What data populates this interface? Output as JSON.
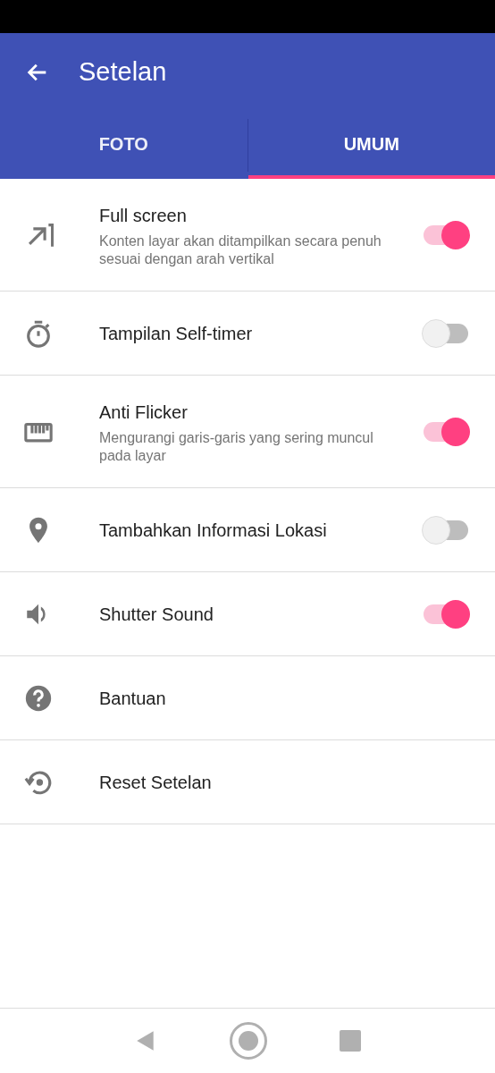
{
  "header": {
    "title": "Setelan"
  },
  "tabs": [
    {
      "label": "FOTO",
      "selected": false
    },
    {
      "label": "UMUM",
      "selected": true
    }
  ],
  "settings": [
    {
      "kind": "toggle",
      "title": "Full screen",
      "description": "Konten layar akan ditampilkan secara penuh sesuai dengan arah vertikal",
      "on": true
    },
    {
      "kind": "toggle",
      "title": "Tampilan Self-timer",
      "on": false
    },
    {
      "kind": "toggle",
      "title": "Anti Flicker",
      "description": "Mengurangi garis-garis yang sering muncul pada layar",
      "on": true
    },
    {
      "kind": "toggle",
      "title": "Tambahkan Informasi Lokasi",
      "on": false
    },
    {
      "kind": "toggle",
      "title": "Shutter Sound",
      "on": true
    },
    {
      "kind": "action",
      "title": "Bantuan"
    },
    {
      "kind": "action",
      "title": "Reset Setelan"
    }
  ]
}
